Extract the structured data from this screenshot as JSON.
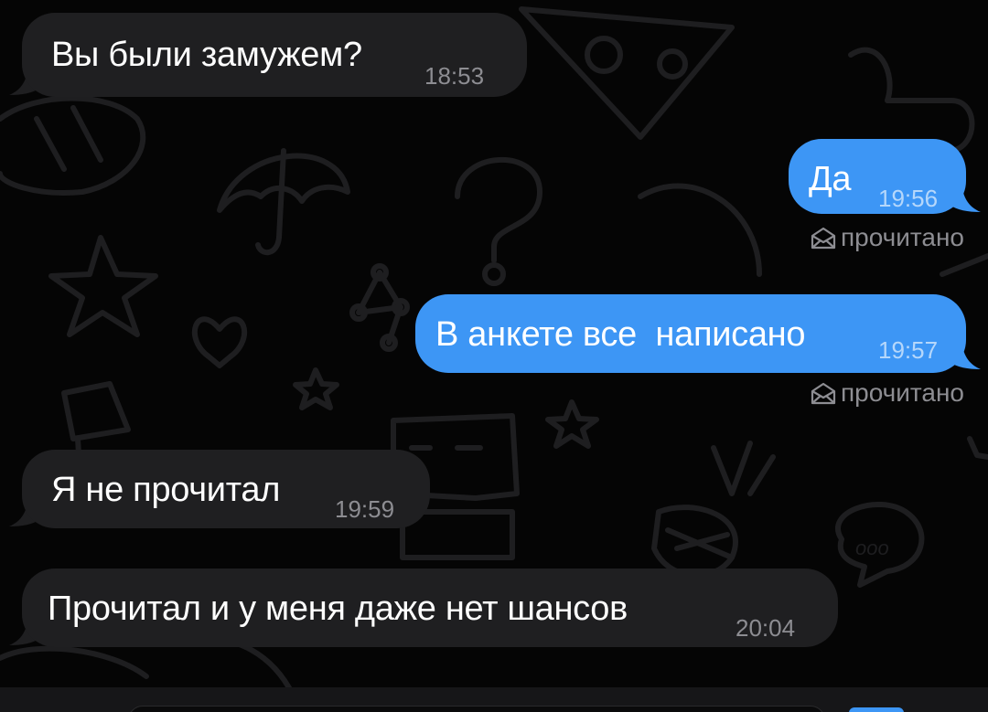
{
  "messages": [
    {
      "direction": "incoming",
      "text": "Вы были замужем?",
      "time": "18:53"
    },
    {
      "direction": "outgoing",
      "text": "Да",
      "time": "19:56",
      "status": "прочитано"
    },
    {
      "direction": "outgoing",
      "text": "В анкете все  написано",
      "time": "19:57",
      "status": "прочитано"
    },
    {
      "direction": "incoming",
      "text": "Я не прочитал",
      "time": "19:59"
    },
    {
      "direction": "incoming",
      "text": "Прочитал и у меня даже нет шансов",
      "time": "20:04"
    }
  ],
  "colors": {
    "incoming_bubble": "#1f1f21",
    "outgoing_bubble": "#3d96f5",
    "background": "#050505",
    "meta_text": "#8d8d92"
  },
  "icons": {
    "read_status": "envelope-open-icon",
    "wallpaper": "doodle-pattern"
  }
}
